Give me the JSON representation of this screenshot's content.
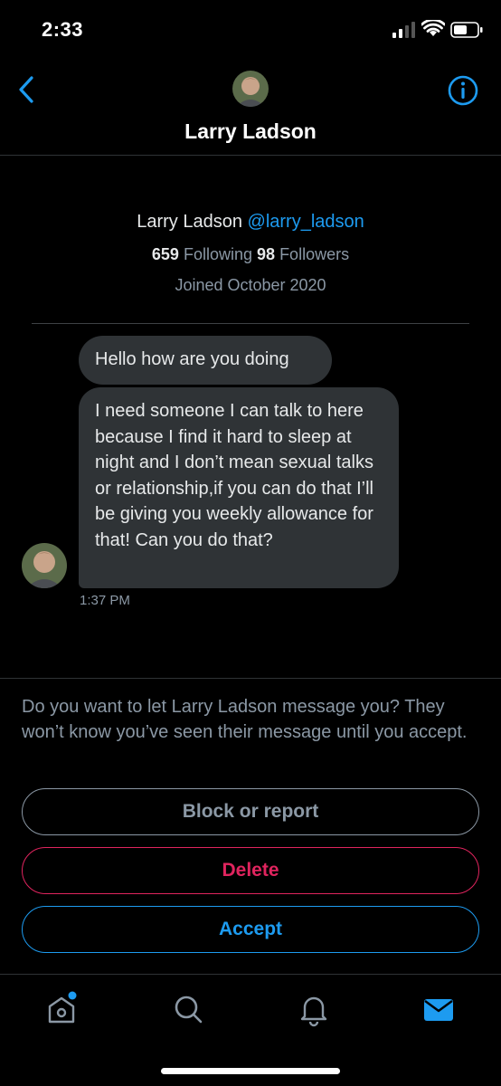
{
  "status_bar": {
    "time": "2:33"
  },
  "header": {
    "back_icon": "chevron-left-icon",
    "info_icon": "info-circle-icon",
    "title": "Larry Ladson"
  },
  "profile": {
    "name": "Larry Ladson",
    "handle": "@larry_ladson",
    "following_count": "659",
    "following_label": "Following",
    "followers_count": "98",
    "followers_label": "Followers",
    "joined": "Joined October 2020"
  },
  "messages": [
    {
      "text": "Hello how are you doing"
    },
    {
      "text": "I need someone I can talk to here because I find it hard to sleep at night and I don’t mean sexual talks or relationship,if you can do that I’ll be giving you weekly allowance for that! Can you do that?"
    }
  ],
  "timestamp": "1:37 PM",
  "request": {
    "prompt": "Do you want to let Larry Ladson message you? They won’t know you’ve seen their message until you accept.",
    "block_label": "Block or report",
    "delete_label": "Delete",
    "accept_label": "Accept"
  },
  "tabbar": {
    "items": [
      {
        "icon": "home-icon",
        "active": false,
        "badge": true
      },
      {
        "icon": "search-icon",
        "active": false
      },
      {
        "icon": "bell-icon",
        "active": false
      },
      {
        "icon": "mail-icon",
        "active": true
      }
    ]
  },
  "colors": {
    "accent": "#1d9bf0",
    "danger": "#e0245e",
    "muted": "#8b98a5",
    "bubble": "#2f3336",
    "background": "#000000"
  }
}
